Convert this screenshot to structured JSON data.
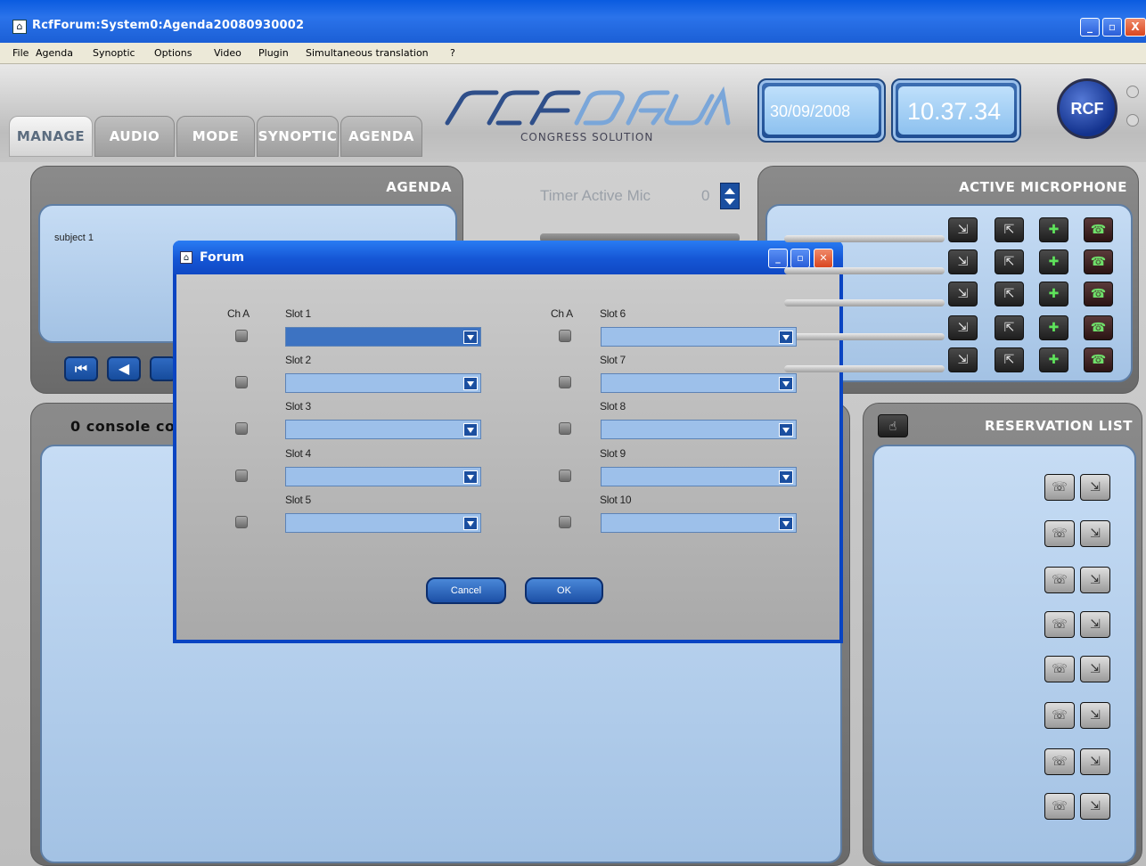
{
  "window": {
    "title": "RcfForum:System0:Agenda20080930002",
    "minimize": "_",
    "maximize": "▫",
    "close": "X"
  },
  "menu": {
    "items": [
      "File",
      "Agenda",
      "Synoptic",
      "Options",
      "Video",
      "Plugin",
      "Simultaneous translation",
      "?"
    ]
  },
  "tabs": [
    "MANAGE",
    "AUDIO",
    "MODE",
    "SYNOPTIC",
    "AGENDA"
  ],
  "active_tab": "MANAGE",
  "logo": {
    "name": "RCF FORUM",
    "subtitle": "CONGRESS SOLUTION"
  },
  "header": {
    "date": "30/09/2008",
    "time": "10.37.34",
    "badge": "RCF"
  },
  "agenda_panel": {
    "title": "AGENDA",
    "subject": "subject 1",
    "nav_buttons": [
      "⏮",
      "◀"
    ]
  },
  "timer": {
    "label": "Timer Active Mic",
    "value": "0"
  },
  "active_microphone": {
    "title": "ACTIVE MICROPHONE",
    "rows": 5
  },
  "console_panel": {
    "title": "0 console conn"
  },
  "reservation_list": {
    "title": "RESERVATION LIST",
    "rows": 8
  },
  "dialog": {
    "title": "Forum",
    "col_header": "Ch A",
    "slots_left": [
      "Slot 1",
      "Slot 2",
      "Slot 3",
      "Slot 4",
      "Slot 5"
    ],
    "slots_right": [
      "Slot 6",
      "Slot 7",
      "Slot 8",
      "Slot 9",
      "Slot 10"
    ],
    "cancel": "Cancel",
    "ok": "OK"
  },
  "colors": {
    "xp_blue": "#0a44c2",
    "panel_blue": "#a3c2e4",
    "panel_gray": "#7a7a7a"
  }
}
